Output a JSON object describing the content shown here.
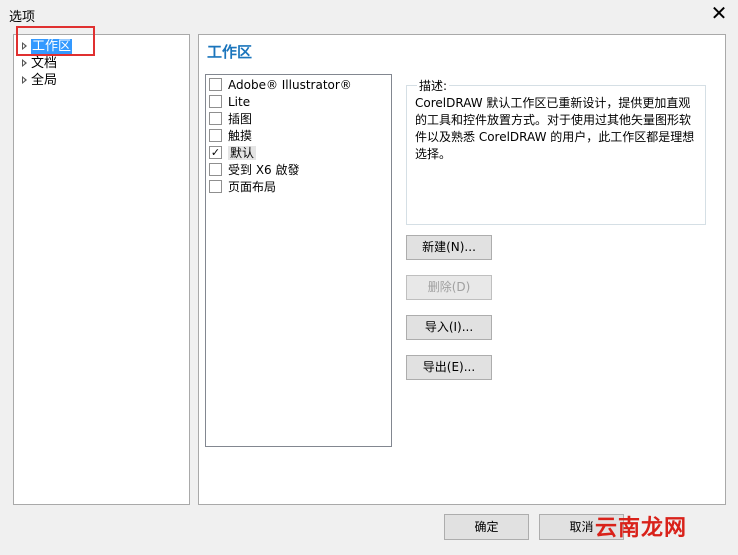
{
  "window": {
    "title": "选项",
    "close_label": "✕"
  },
  "tree": {
    "items": [
      {
        "label": "工作区",
        "selected": true
      },
      {
        "label": "文档",
        "selected": false
      },
      {
        "label": "全局",
        "selected": false
      }
    ]
  },
  "panel": {
    "title": "工作区",
    "workspaces": [
      {
        "label": "Adobe® Illustrator®",
        "checked": false
      },
      {
        "label": "Lite",
        "checked": false
      },
      {
        "label": "插图",
        "checked": false
      },
      {
        "label": "触摸",
        "checked": false
      },
      {
        "label": "默认",
        "checked": true
      },
      {
        "label": "受到 X6 啟發",
        "checked": false
      },
      {
        "label": "页面布局",
        "checked": false
      }
    ],
    "description_label": "描述:",
    "description_text": "CorelDRAW 默认工作区已重新设计，提供更加直观的工具和控件放置方式。对于使用过其他矢量图形软件以及熟悉 CorelDRAW 的用户，此工作区都是理想选择。",
    "buttons": {
      "new": "新建(N)...",
      "delete": "删除(D)",
      "import": "导入(I)...",
      "export": "导出(E)..."
    }
  },
  "footer": {
    "ok": "确定",
    "cancel": "取消"
  },
  "watermark": "云南龙网",
  "colors": {
    "accent": "#1b75bc",
    "selection": "#3399ff",
    "highlight_box": "#e03030"
  }
}
